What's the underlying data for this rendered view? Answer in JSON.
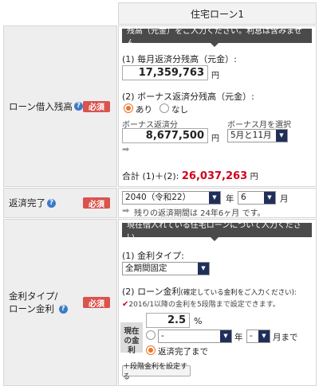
{
  "header": {
    "title": "住宅ローン1"
  },
  "row1": {
    "label": "ローン借入残高",
    "required": "必須",
    "banner": "残高（元金）をご入力ください。利息は含みません。",
    "monthly_label": "(1) 毎月返済分残高（元金）:",
    "monthly_value": "17,359,763",
    "yen": "円",
    "bonus_label": "(2) ボーナス返済分残高（元金）:",
    "radio_yes": "あり",
    "radio_no": "なし",
    "bonus_amount_label": "ボーナス返済分",
    "bonus_amount_value": "8,677,500",
    "bonus_month_label": "ボーナス月を選択",
    "bonus_month_value": "5月と11月",
    "total_label": "合計 (1)＋(2):",
    "total_value": "26,037,263",
    "total_unit": "円"
  },
  "row2": {
    "label": "返済完了",
    "required": "必須",
    "year_value": "2040（令和22）",
    "year_unit": "年",
    "month_value": "6",
    "month_unit": "月",
    "remaining_text": "残りの返済期間は 24年6ヶ月 です。"
  },
  "row3": {
    "label_line1": "金利タイプ/",
    "label_line2": "ローン金利",
    "required": "必須",
    "banner": "現在借入れている住宅ローンについて入力ください。",
    "rate_type_label": "(1) 金利タイプ:",
    "rate_type_value": "全期間固定",
    "rate_label": "(2) ローン金利",
    "rate_note": "(確定している金利をご入力ください):",
    "check_note": "2016/1以降の金利を5段階まで設定できます。",
    "current_rate_label": "現在の金利",
    "rate_value": "2.5",
    "percent": "%",
    "until_year_value": "-",
    "until_year_unit": "年",
    "until_month_value": "-",
    "until_month_unit": "月まで",
    "until_complete": "返済完了まで",
    "set_button": "＋段階金利を設定する"
  }
}
